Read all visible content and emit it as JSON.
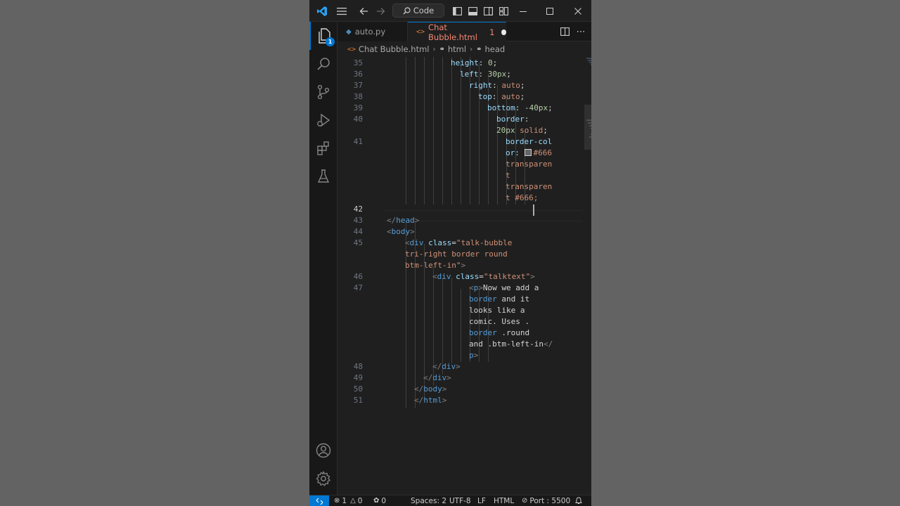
{
  "titlebar": {
    "search_label": "Code"
  },
  "activity": {
    "explorer_badge": "1"
  },
  "tabs": [
    {
      "label": "auto.py"
    },
    {
      "label": "Chat Bubble.html",
      "problems": "1"
    }
  ],
  "breadcrumbs": [
    "Chat Bubble.html",
    "html",
    "head"
  ],
  "editor": {
    "line_numbers": [
      "35",
      "36",
      "37",
      "38",
      "39",
      "40",
      "41",
      "42",
      "43",
      "44",
      "45",
      "46",
      "47",
      "48",
      "49",
      "50",
      "51"
    ],
    "current_line": "42",
    "swatch_color": "#666666"
  },
  "code": {
    "l35": [
      "height",
      ": ",
      "0",
      ";"
    ],
    "l36": [
      "left",
      ": ",
      "30px",
      ";"
    ],
    "l37": [
      "right",
      ": ",
      "auto",
      ";"
    ],
    "l38": [
      "top",
      ": ",
      "auto",
      ";"
    ],
    "l39": [
      "bottom",
      ": ",
      "-40px",
      ";"
    ],
    "l40a": [
      "border",
      ":"
    ],
    "l40b": [
      "20px",
      " ",
      "solid",
      ";"
    ],
    "l41a": "border-col",
    "l41b_pre": "or: ",
    "l41b_val": "#666",
    "l41c": "transparen",
    "l41d": "t",
    "l41e": "transparen",
    "l41f": "t #666;",
    "l43": [
      "</",
      "head",
      ">"
    ],
    "l44": [
      "<",
      "body",
      ">"
    ],
    "l45a": [
      "<",
      "div",
      " ",
      "class",
      "=",
      "\"talk-bubble"
    ],
    "l45b": "tri-right border round",
    "l45c": [
      "btm-left-in\"",
      ">"
    ],
    "l46": [
      "<",
      "div",
      " ",
      "class",
      "=",
      "\"talktext\"",
      ">"
    ],
    "l47a": [
      "<",
      "p",
      ">",
      "Now we add a"
    ],
    "l47b": [
      "border",
      " and it"
    ],
    "l47c": "looks like a",
    "l47d": "comic. Uses .",
    "l47e": [
      "border",
      " .round"
    ],
    "l47f": [
      "and .btm-left-in",
      "</"
    ],
    "l47g": [
      "p",
      ">"
    ],
    "l48": [
      "</",
      "div",
      ">"
    ],
    "l49": [
      "</",
      "div",
      ">"
    ],
    "l50": [
      "</",
      "body",
      ">"
    ],
    "l51": [
      "</",
      "html",
      ">"
    ]
  },
  "status": {
    "errors": "1",
    "warnings": "0",
    "ports": "0",
    "spaces": "Spaces: 2",
    "encoding": "UTF-8",
    "eol": "LF",
    "language": "HTML",
    "port": "Port : 5500"
  },
  "colors": {
    "accent": "#0078d4",
    "modified_tab": "#f48771"
  }
}
